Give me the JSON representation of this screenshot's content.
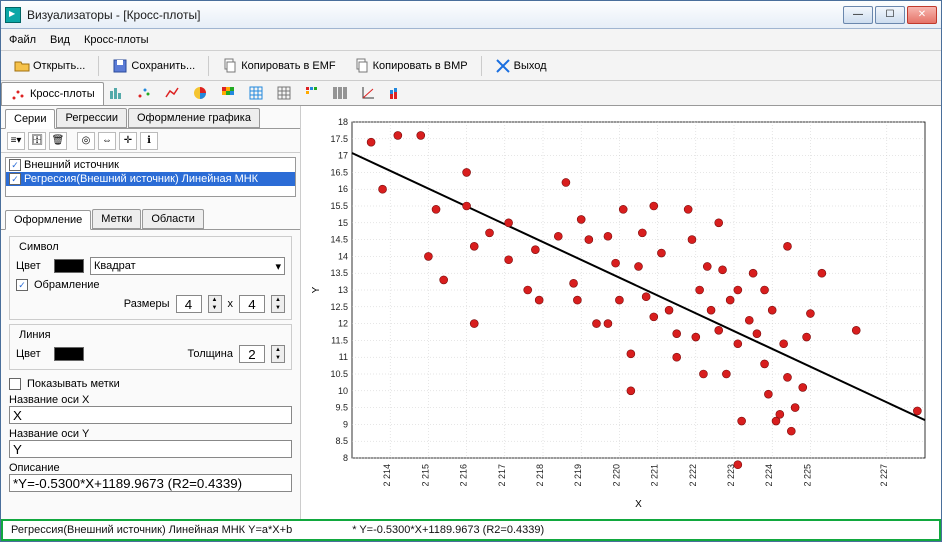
{
  "window": {
    "title": "Визуализаторы - [Кросс-плоты]"
  },
  "menu": {
    "file": "Файл",
    "view": "Вид",
    "crossplots": "Кросс-плоты"
  },
  "toolbar": {
    "open": "Открыть...",
    "save": "Сохранить...",
    "copy_emf": "Копировать в EMF",
    "copy_bmp": "Копировать в BMP",
    "exit": "Выход"
  },
  "toolbar2": {
    "crossplots": "Кросс-плоты"
  },
  "side": {
    "tabs": [
      "Серии",
      "Регрессии",
      "Оформление графика"
    ],
    "series": [
      {
        "label": "Внешний источник"
      },
      {
        "label": "Регрессия(Внешний источник)  Линейная МНК"
      }
    ],
    "tabs2": [
      "Оформление",
      "Метки",
      "Области"
    ]
  },
  "style": {
    "symbol": {
      "title": "Символ",
      "color_label": "Цвет",
      "shape": "Квадрат",
      "outline": "Обрамление",
      "size_label": "Размеры",
      "w": "4",
      "h": "4"
    },
    "line": {
      "title": "Линия",
      "color_label": "Цвет",
      "thickness_label": "Толщина",
      "thickness": "2"
    },
    "show_labels": "Показывать метки",
    "x_axis_label": "Название оси X",
    "x_axis_value": "X",
    "y_axis_label": "Название оси Y",
    "y_axis_value": "Y",
    "desc_label": "Описание",
    "desc_value": "*Y=-0.5300*X+1189.9673 (R2=0.4339)"
  },
  "status": {
    "left": "Регрессия(Внешний источник) Линейная МНК Y=a*X+b",
    "right": "* Y=-0.5300*X+1189.9673 (R2=0.4339)"
  },
  "chart_data": {
    "type": "scatter",
    "xlabel": "X",
    "ylabel": "Y",
    "xlim": [
      2213,
      2228
    ],
    "ylim": [
      8,
      18
    ],
    "xticks": [
      2214,
      2215,
      2216,
      2217,
      2218,
      2219,
      2220,
      2221,
      2222,
      2223,
      2224,
      2225,
      2227
    ],
    "yticks": [
      8,
      8.5,
      9,
      9.5,
      10,
      10.5,
      11,
      11.5,
      12,
      12.5,
      13,
      13.5,
      14,
      14.5,
      15,
      15.5,
      16,
      16.5,
      17,
      17.5,
      18
    ],
    "points": [
      {
        "x": 2213.5,
        "y": 17.4
      },
      {
        "x": 2213.8,
        "y": 16.0
      },
      {
        "x": 2214.2,
        "y": 17.6
      },
      {
        "x": 2214.8,
        "y": 17.6
      },
      {
        "x": 2215.2,
        "y": 15.4
      },
      {
        "x": 2215.4,
        "y": 13.3
      },
      {
        "x": 2216.0,
        "y": 15.5
      },
      {
        "x": 2216.2,
        "y": 14.3
      },
      {
        "x": 2216.2,
        "y": 12.0
      },
      {
        "x": 2216.0,
        "y": 16.5
      },
      {
        "x": 2215.0,
        "y": 14.0
      },
      {
        "x": 2216.6,
        "y": 14.7
      },
      {
        "x": 2217.1,
        "y": 13.9
      },
      {
        "x": 2217.1,
        "y": 15.0
      },
      {
        "x": 2217.9,
        "y": 12.7
      },
      {
        "x": 2217.6,
        "y": 13.0
      },
      {
        "x": 2217.8,
        "y": 14.2
      },
      {
        "x": 2218.4,
        "y": 14.6
      },
      {
        "x": 2218.8,
        "y": 13.2
      },
      {
        "x": 2218.9,
        "y": 12.7
      },
      {
        "x": 2218.6,
        "y": 16.2
      },
      {
        "x": 2219.2,
        "y": 14.5
      },
      {
        "x": 2219.0,
        "y": 15.1
      },
      {
        "x": 2219.4,
        "y": 12.0
      },
      {
        "x": 2219.7,
        "y": 12.0
      },
      {
        "x": 2219.9,
        "y": 13.8
      },
      {
        "x": 2219.7,
        "y": 14.6
      },
      {
        "x": 2220.1,
        "y": 15.4
      },
      {
        "x": 2220.3,
        "y": 11.1
      },
      {
        "x": 2220.3,
        "y": 10.0
      },
      {
        "x": 2220.0,
        "y": 12.7
      },
      {
        "x": 2220.5,
        "y": 13.7
      },
      {
        "x": 2220.7,
        "y": 12.8
      },
      {
        "x": 2220.9,
        "y": 12.2
      },
      {
        "x": 2220.6,
        "y": 14.7
      },
      {
        "x": 2221.1,
        "y": 14.1
      },
      {
        "x": 2221.3,
        "y": 12.4
      },
      {
        "x": 2220.9,
        "y": 15.5
      },
      {
        "x": 2221.5,
        "y": 11.0
      },
      {
        "x": 2221.5,
        "y": 11.7
      },
      {
        "x": 2221.9,
        "y": 14.5
      },
      {
        "x": 2222.1,
        "y": 13.0
      },
      {
        "x": 2221.8,
        "y": 15.4
      },
      {
        "x": 2222.3,
        "y": 13.7
      },
      {
        "x": 2222.0,
        "y": 11.6
      },
      {
        "x": 2222.4,
        "y": 12.4
      },
      {
        "x": 2222.2,
        "y": 10.5
      },
      {
        "x": 2222.6,
        "y": 11.8
      },
      {
        "x": 2222.8,
        "y": 10.5
      },
      {
        "x": 2222.9,
        "y": 12.7
      },
      {
        "x": 2222.7,
        "y": 13.6
      },
      {
        "x": 2223.1,
        "y": 13.0
      },
      {
        "x": 2222.6,
        "y": 15.0
      },
      {
        "x": 2223.2,
        "y": 9.1
      },
      {
        "x": 2223.1,
        "y": 11.4
      },
      {
        "x": 2223.4,
        "y": 12.1
      },
      {
        "x": 2223.1,
        "y": 7.8
      },
      {
        "x": 2223.5,
        "y": 13.5
      },
      {
        "x": 2223.6,
        "y": 11.7
      },
      {
        "x": 2223.8,
        "y": 10.8
      },
      {
        "x": 2223.9,
        "y": 9.9
      },
      {
        "x": 2224.1,
        "y": 9.1
      },
      {
        "x": 2224.2,
        "y": 9.3
      },
      {
        "x": 2223.8,
        "y": 13.0
      },
      {
        "x": 2224.3,
        "y": 11.4
      },
      {
        "x": 2224.0,
        "y": 12.4
      },
      {
        "x": 2224.5,
        "y": 8.8
      },
      {
        "x": 2224.4,
        "y": 10.4
      },
      {
        "x": 2224.6,
        "y": 9.5
      },
      {
        "x": 2225.0,
        "y": 12.3
      },
      {
        "x": 2224.8,
        "y": 10.1
      },
      {
        "x": 2225.3,
        "y": 13.5
      },
      {
        "x": 2224.9,
        "y": 11.6
      },
      {
        "x": 2224.4,
        "y": 14.3
      },
      {
        "x": 2226.2,
        "y": 11.8
      },
      {
        "x": 2227.8,
        "y": 9.4
      }
    ],
    "regression": {
      "slope": -0.53,
      "intercept": 1189.9673,
      "r2": 0.4339
    }
  }
}
